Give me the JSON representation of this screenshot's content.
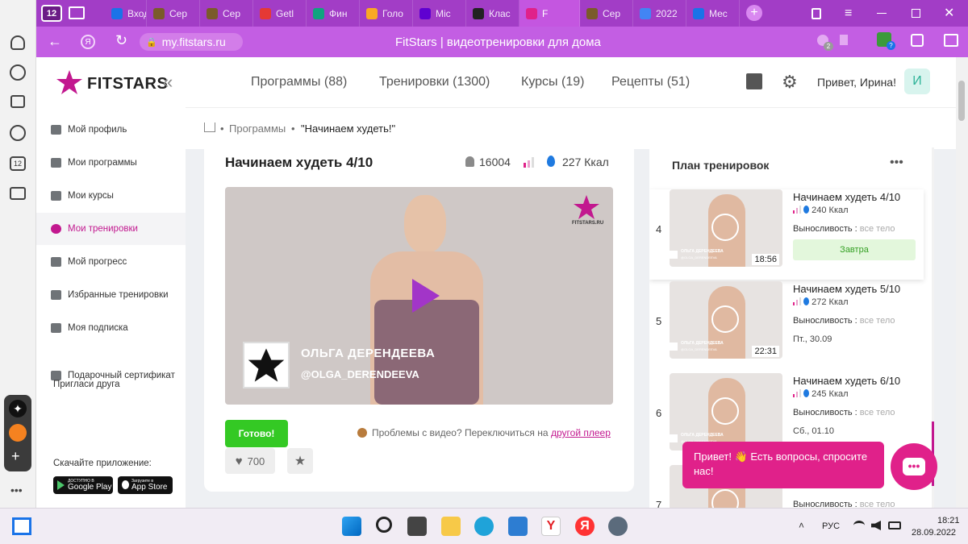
{
  "browser": {
    "tab_count": "12",
    "tabs": [
      {
        "label": "Вход",
        "color": "#1a73e8"
      },
      {
        "label": "Сер",
        "color": "#7a5b2a"
      },
      {
        "label": "Сер",
        "color": "#7a5b2a"
      },
      {
        "label": "Getl",
        "color": "#e53935"
      },
      {
        "label": "Фин",
        "color": "#10a37f"
      },
      {
        "label": "Голо",
        "color": "#f9a825"
      },
      {
        "label": "Mic",
        "color": "#5f01d1"
      },
      {
        "label": "Клас",
        "color": "#222222"
      },
      {
        "label": "F",
        "color": "#e0218a",
        "active": true
      },
      {
        "label": "Сер",
        "color": "#7a5b2a"
      },
      {
        "label": "2022",
        "color": "#4285f4"
      },
      {
        "label": "Мес",
        "color": "#1a73e8"
      }
    ],
    "url": "my.fitstars.ru",
    "page_title": "FitStars | видеотренировки для дома",
    "notif_badge": "2",
    "ext_badge": "?",
    "side_badge": "12"
  },
  "site": {
    "logo": "FITSTARS",
    "nav": [
      "Программы (88)",
      "Тренировки (1300)",
      "Курсы (19)",
      "Рецепты (51)"
    ],
    "greeting": "Привет, Ирина!",
    "avatar_letter": "И",
    "breadcrumb": {
      "programs": "Программы",
      "current": "\"Начинаем худеть!\""
    },
    "sidebar": [
      {
        "label": "Мой профиль"
      },
      {
        "label": "Мои программы"
      },
      {
        "label": "Мои курсы"
      },
      {
        "label": "Мои тренировки",
        "active": true
      },
      {
        "label": "Мой прогресс"
      },
      {
        "label": "Избранные тренировки"
      },
      {
        "label": "Моя подписка"
      },
      {
        "label": "Подарочный сертификат"
      },
      {
        "label": "Пригласи друга"
      }
    ],
    "app_download": "Скачайте приложение:",
    "google_play": {
      "small": "ДОСТУПНО В",
      "big": "Google Play"
    },
    "app_store": {
      "small": "Загрузите в",
      "big": "App Store"
    }
  },
  "workout": {
    "title": "Начинаем худеть 4/10",
    "views": "16004",
    "calories": "227 Ккал",
    "video": {
      "brand": "FITSTARS.RU",
      "trainer_name": "ОЛЬГА ДЕРЕНДЕЕВА",
      "trainer_handle": "@OLGA_DERENDEEVA"
    },
    "done_label": "Готово!",
    "problem_text": "Проблемы с видео? Переключиться на",
    "player_link": "другой плеер",
    "likes": "700"
  },
  "plan": {
    "title": "План тренировок",
    "endurance_label": "Выносливость :",
    "endurance_value": "все тело",
    "items": [
      {
        "num": "4",
        "title": "Начинаем худеть 4/10",
        "kcal": "240 Ккал",
        "duration": "18:56",
        "badge": "Завтра",
        "date": ""
      },
      {
        "num": "5",
        "title": "Начинаем худеть 5/10",
        "kcal": "272 Ккал",
        "duration": "22:31",
        "badge": "",
        "date": "Пт., 30.09"
      },
      {
        "num": "6",
        "title": "Начинаем худеть 6/10",
        "kcal": "245 Ккал",
        "duration": "",
        "badge": "",
        "date": "Сб., 01.10"
      },
      {
        "num": "7",
        "title": "",
        "kcal": "",
        "duration": "",
        "badge": "",
        "date": ""
      }
    ],
    "thumb_name": "ОЛЬГА ДЕРЕНДЕЕВА",
    "thumb_handle": "@OLGA_DERENDEEVA"
  },
  "chat": {
    "text": "Привет! 👋 Есть вопросы, спросите нас!"
  },
  "taskbar": {
    "lang": "РУС",
    "time": "18:21",
    "date": "28.09.2022"
  },
  "colors": {
    "brand": "#c2188f",
    "browser": "#a23dc6",
    "done": "#34c924",
    "chat": "#e0218a"
  }
}
